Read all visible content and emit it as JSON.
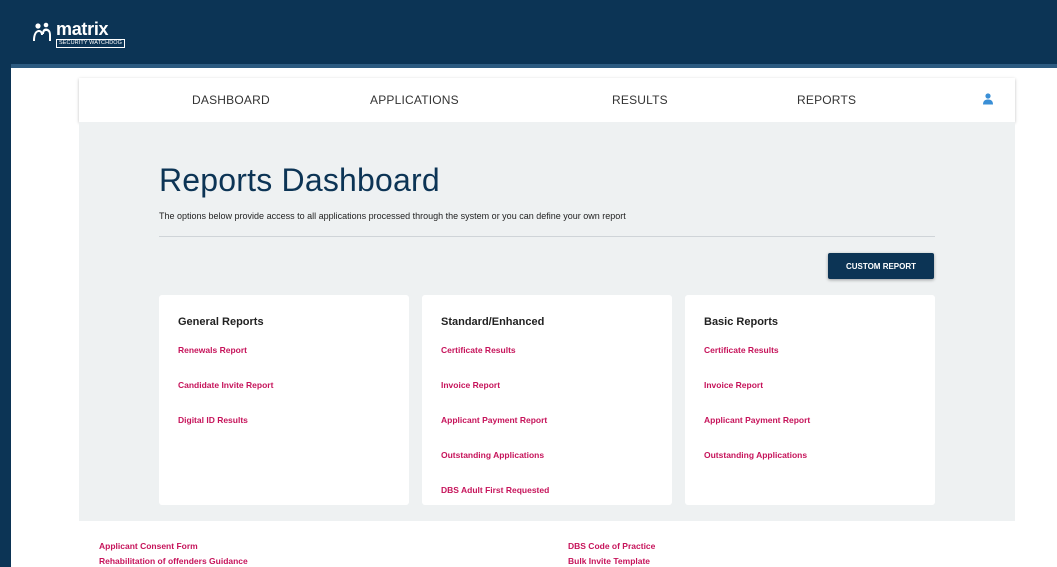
{
  "brand": {
    "name": "matrix",
    "tagline": "SECURITY WATCHDOG"
  },
  "colors": {
    "primary": "#0c3455",
    "accent_link": "#c6135a",
    "panel_bg": "#eef1f2",
    "user_icon": "#3a8fd6"
  },
  "icons": {
    "logo": "people-icon",
    "user": "user-icon"
  },
  "nav": {
    "dashboard": "DASHBOARD",
    "applications": "APPLICATIONS",
    "results": "RESULTS",
    "reports": "REPORTS"
  },
  "main": {
    "title": "Reports Dashboard",
    "subtitle": "The options below provide access to all applications processed through the system or you can define your own report",
    "custom_report_button": "CUSTOM REPORT"
  },
  "cards": [
    {
      "title": "General Reports",
      "links": [
        "Renewals Report",
        "Candidate Invite Report",
        "Digital ID Results"
      ]
    },
    {
      "title": "Standard/Enhanced",
      "links": [
        "Certificate Results",
        "Invoice Report",
        "Applicant Payment Report",
        "Outstanding Applications",
        "DBS Adult First Requested"
      ]
    },
    {
      "title": "Basic Reports",
      "links": [
        "Certificate Results",
        "Invoice Report",
        "Applicant Payment Report",
        "Outstanding Applications"
      ]
    }
  ],
  "footer": {
    "applicant_consent_form": "Applicant Consent Form",
    "rehabilitation_guidance": "Rehabilitation of offenders Guidance",
    "dbs_code_of_practice": "DBS Code of Practice",
    "bulk_invite_template": "Bulk Invite Template"
  }
}
